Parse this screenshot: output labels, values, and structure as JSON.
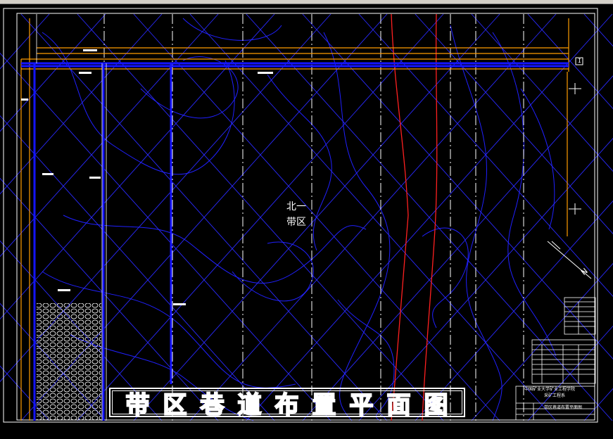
{
  "viewer": {
    "background": "#000000",
    "chrome_color": "#d4d0c8"
  },
  "drawing": {
    "title": "带区巷道布置平面图",
    "region_label_line1": "北一",
    "region_label_line2": "带区",
    "sheet_marker": "I",
    "colors": {
      "frame": "#ffffff",
      "contour": "#2020ff",
      "roadway": "#1414ff",
      "fault": "#ff2020",
      "boundary_orange": "#ff9c00",
      "dash": "#ffffff"
    }
  },
  "title_block": {
    "line1": "中国矿业大学矿业工程学院",
    "line2": "采矿工程系",
    "line3": "带区巷道布置平面图"
  }
}
